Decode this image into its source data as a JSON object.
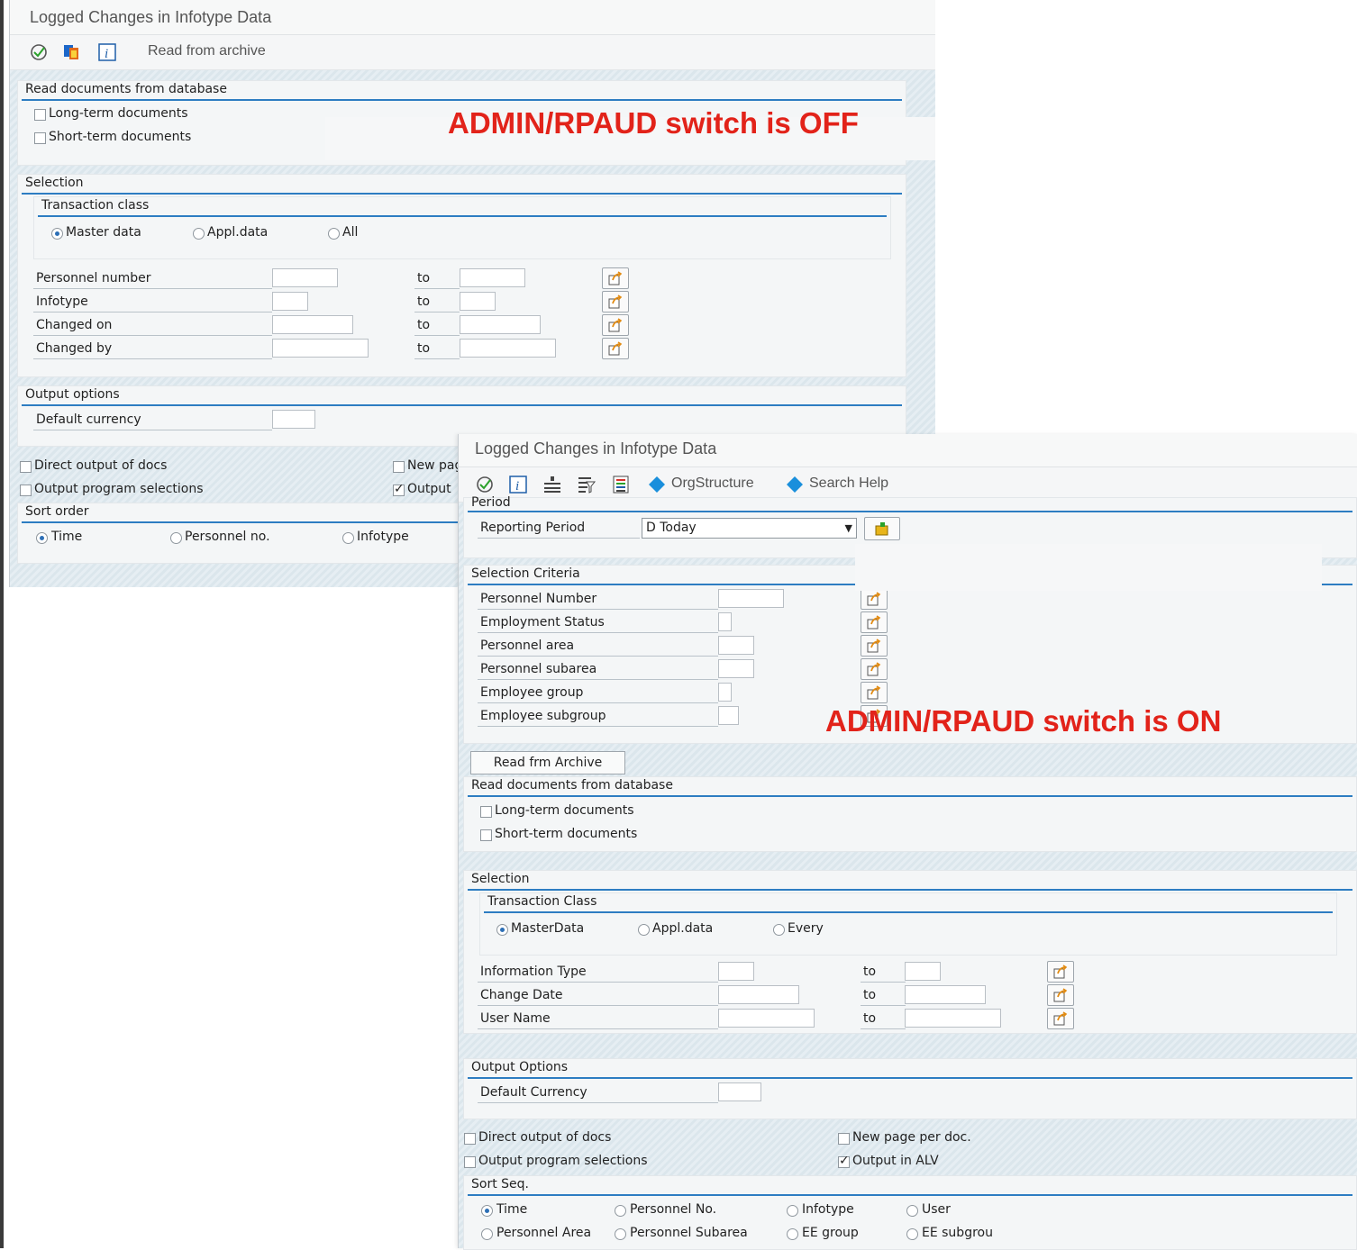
{
  "win1": {
    "title": "Logged Changes in Infotype Data",
    "toolbar": {
      "read_archive": "Read from archive"
    },
    "read_docs": {
      "title": "Read documents from database",
      "long_term": "Long-term documents",
      "short_term": "Short-term documents"
    },
    "selection": {
      "title": "Selection",
      "trans_class": {
        "title": "Transaction class",
        "opt1": "Master data",
        "opt2": "Appl.data",
        "opt3": "All"
      },
      "rows": [
        {
          "label": "Personnel number",
          "to": "to"
        },
        {
          "label": "Infotype",
          "to": "to"
        },
        {
          "label": "Changed on",
          "to": "to"
        },
        {
          "label": "Changed by",
          "to": "to"
        }
      ]
    },
    "output": {
      "title": "Output options",
      "currency": "Default currency"
    },
    "checks": {
      "direct": "Direct output of docs",
      "prog_sel": "Output program selections",
      "new_page": "New pag",
      "output_alv": "Output"
    },
    "sort": {
      "title": "Sort order",
      "opt1": "Time",
      "opt2": "Personnel no.",
      "opt3": "Infotype"
    }
  },
  "annot_off": "ADMIN/RPAUD switch is OFF",
  "annot_on": "ADMIN/RPAUD switch is ON",
  "win2": {
    "title": "Logged Changes in Infotype Data",
    "toolbar": {
      "org": "OrgStructure",
      "search": "Search Help"
    },
    "period": {
      "title": "Period",
      "label": "Reporting Period",
      "value": "D Today"
    },
    "criteria": {
      "title": "Selection Criteria",
      "rows": [
        "Personnel Number",
        "Employment Status",
        "Personnel area",
        "Personnel subarea",
        "Employee group",
        "Employee subgroup"
      ]
    },
    "archive_btn": "Read frm Archive",
    "read_docs": {
      "title": "Read documents from database",
      "long_term": "Long-term documents",
      "short_term": "Short-term documents"
    },
    "selection": {
      "title": "Selection",
      "trans_class": {
        "title": "Transaction Class",
        "opt1": "MasterData",
        "opt2": "Appl.data",
        "opt3": "Every"
      },
      "rows": [
        {
          "label": "Information Type",
          "to": "to"
        },
        {
          "label": "Change Date",
          "to": "to"
        },
        {
          "label": "User Name",
          "to": "to"
        }
      ]
    },
    "output": {
      "title": "Output Options",
      "currency": "Default Currency"
    },
    "checks": {
      "direct": "Direct output of docs",
      "prog_sel": "Output program selections",
      "new_page": "New page per doc.",
      "output_alv": "Output in ALV"
    },
    "sort": {
      "title": "Sort Seq.",
      "opts": [
        "Time",
        "Personnel No.",
        "Infotype",
        "User",
        "Personnel Area",
        "Personnel Subarea",
        "EE group",
        "EE subgrou"
      ]
    }
  }
}
